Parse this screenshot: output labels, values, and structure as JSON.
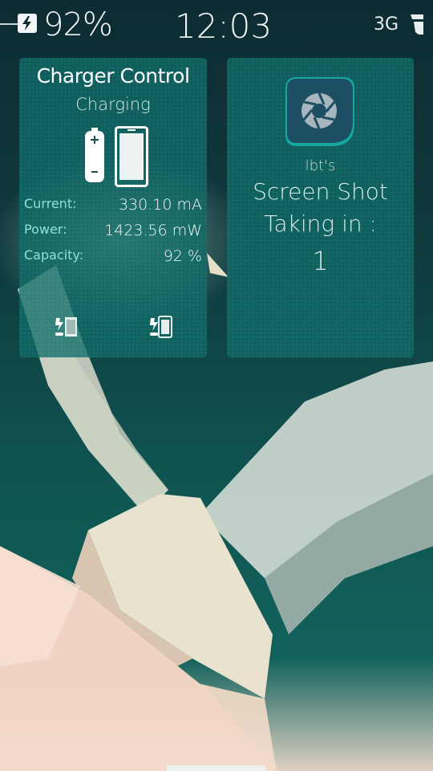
{
  "status_bar": {
    "battery_percent": "92%",
    "time": "12:03",
    "network": "3G",
    "charging_icon": "lightning-bolt-icon",
    "signal_icon": "signal-strength-icon"
  },
  "charger_card": {
    "title": "Charger Control",
    "status": "Charging",
    "rows": [
      {
        "label": "Current:",
        "value": "330.10 mA"
      },
      {
        "label": "Power:",
        "value": "1423.56 mW"
      },
      {
        "label": "Capacity:",
        "value": "92 %"
      }
    ],
    "buttons": [
      {
        "icon": "battery-charge-off-icon"
      },
      {
        "icon": "phone-charge-icon"
      }
    ]
  },
  "screenshot_card": {
    "icon": "camera-aperture-icon",
    "author": "lbt's",
    "title": "Screen Shot",
    "subtitle": "Taking in :",
    "countdown": "1"
  },
  "colors": {
    "accent": "#8fe0dc",
    "card_bg": "#0e6c68",
    "background": "#0f4a4a"
  }
}
